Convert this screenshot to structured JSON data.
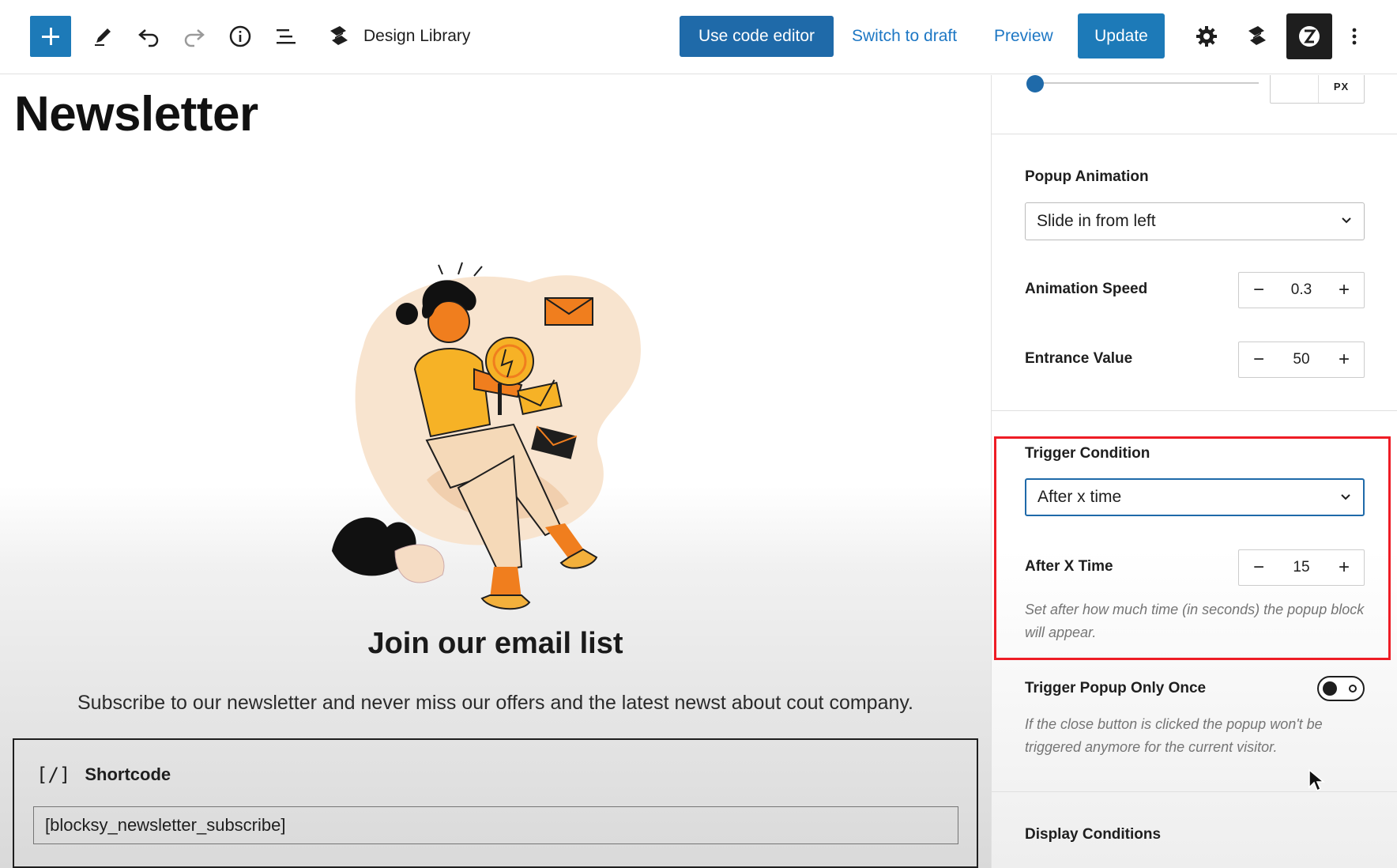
{
  "toolbar": {
    "document_title": "Design Library",
    "use_code_editor_label": "Use code editor",
    "switch_to_draft_label": "Switch to draft",
    "preview_label": "Preview",
    "update_label": "Update",
    "icons": [
      "plus-icon",
      "pencil-icon",
      "undo-icon",
      "redo-icon",
      "info-icon",
      "list-view-icon",
      "blocksy-logo-icon",
      "gear-icon",
      "blocksy-icon",
      "block-editor-icon",
      "more-vertical-icon"
    ]
  },
  "canvas": {
    "page_title": "Newsletter",
    "heading": "Join our email list",
    "subscribe_text": "Subscribe to our newsletter and never miss our offers and the latest newst about cout company.",
    "shortcode_block": {
      "icon_text": "[/]",
      "title": "Shortcode",
      "value": "[blocksy_newsletter_subscribe]"
    }
  },
  "sidebar": {
    "slider": {
      "unit": "PX",
      "value": 0
    },
    "popup_animation": {
      "label": "Popup Animation",
      "value": "Slide in from left"
    },
    "animation_speed": {
      "label": "Animation Speed",
      "value": "0.3"
    },
    "entrance_value": {
      "label": "Entrance Value",
      "value": "50"
    },
    "trigger_condition": {
      "label": "Trigger Condition",
      "value": "After x time"
    },
    "after_x_time": {
      "label": "After X Time",
      "value": "15",
      "help": "Set after how much time (in seconds) the popup block will appear."
    },
    "trigger_once": {
      "label": "Trigger Popup Only Once",
      "enabled": false,
      "help": "If the close button is clicked the popup won't be triggered anymore for the current visitor."
    },
    "display_conditions": {
      "label": "Display Conditions"
    }
  },
  "stepper_symbols": {
    "minus": "−",
    "plus": "+"
  },
  "colors": {
    "accent": "#1d7ab8",
    "code_button": "#1f6aa9",
    "link": "#1d77c4",
    "highlight": "#ee1c25"
  }
}
